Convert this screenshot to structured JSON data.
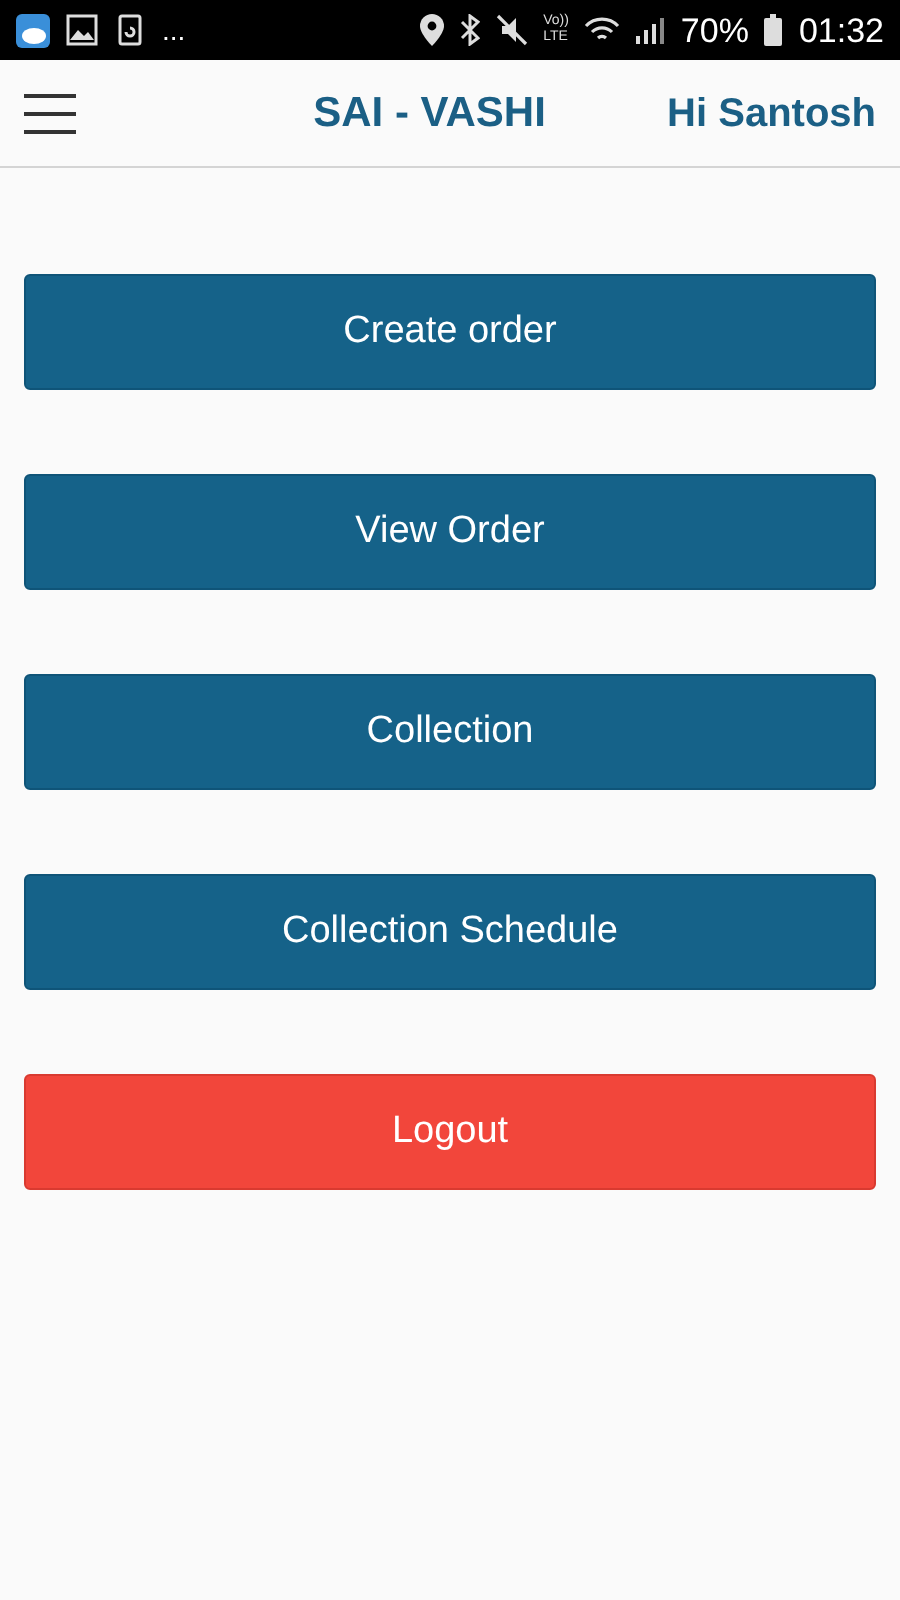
{
  "status_bar": {
    "overflow": "...",
    "network_label": [
      "Vo))",
      "LTE"
    ],
    "battery": "70%",
    "time": "01:32"
  },
  "header": {
    "title": "SAI - VASHI",
    "greeting": "Hi Santosh"
  },
  "buttons": [
    {
      "label": "Create order",
      "kind": "primary"
    },
    {
      "label": "View Order",
      "kind": "primary"
    },
    {
      "label": "Collection",
      "kind": "primary"
    },
    {
      "label": "Collection Schedule",
      "kind": "primary"
    },
    {
      "label": "Logout",
      "kind": "danger"
    }
  ]
}
